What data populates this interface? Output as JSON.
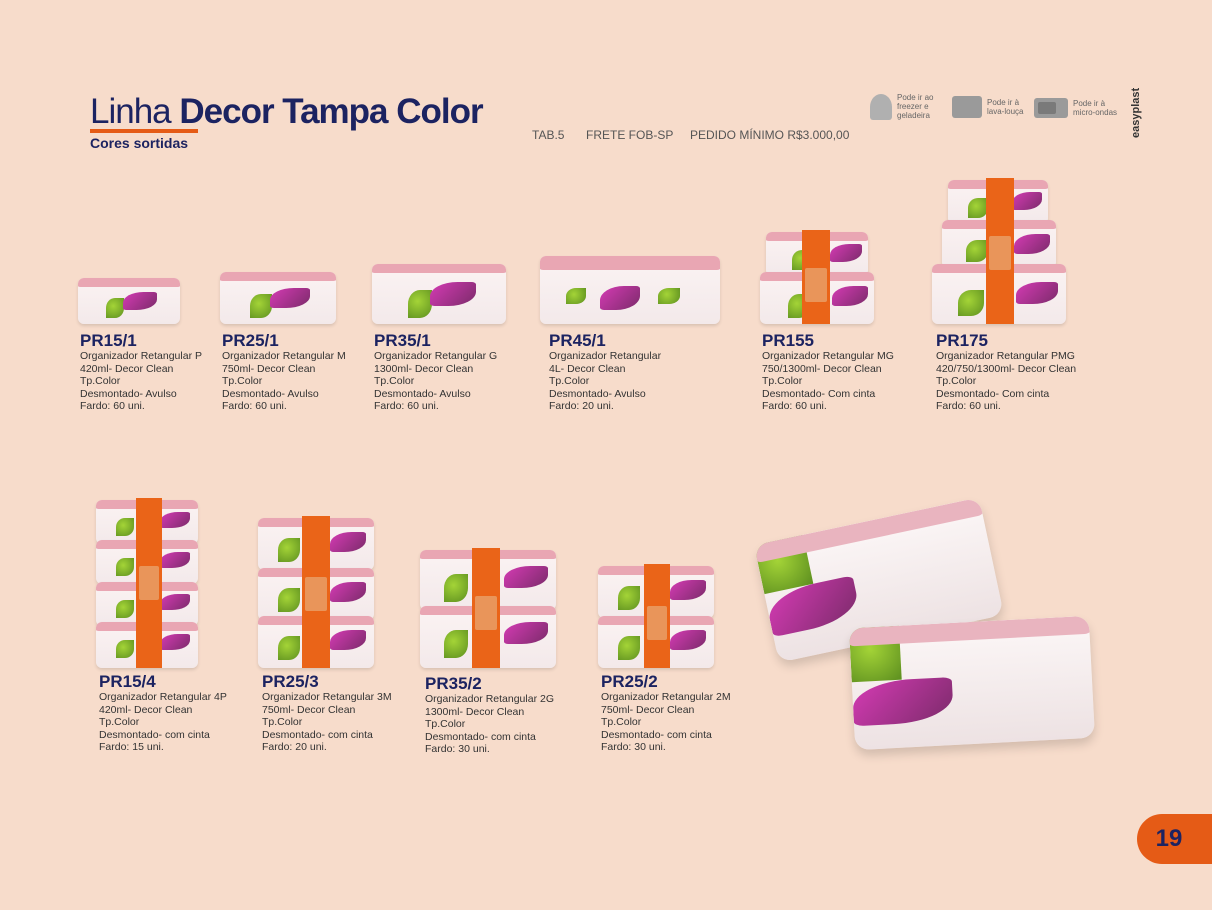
{
  "header": {
    "title_light": "Linha ",
    "title_bold": "Decor Tampa Color",
    "subtitle": "Cores sortidas",
    "tab": "TAB.5",
    "frete": "FRETE FOB-SP",
    "pedido": "PEDIDO MÍNIMO R$3.000,00"
  },
  "features": [
    {
      "icon": "snowflake-freezer-icon",
      "label1": "Pode ir ao",
      "label2": "freezer e",
      "label3": "geladeira"
    },
    {
      "icon": "dishwasher-icon",
      "label1": "Pode ir à",
      "label2": "lava-louça",
      "label3": ""
    },
    {
      "icon": "microwave-icon",
      "label1": "Pode ir à",
      "label2": "micro-ondas",
      "label3": ""
    }
  ],
  "brand": "easyplast",
  "products_top": [
    {
      "code": "PR15/1",
      "l1": "Organizador Retangular P",
      "l2": "420ml- Decor Clean",
      "l3": "Tp.Color",
      "l4": "Desmontado- Avulso",
      "l5": "Fardo: 60 uni."
    },
    {
      "code": "PR25/1",
      "l1": "Organizador Retangular M",
      "l2": "750ml- Decor Clean",
      "l3": "Tp.Color",
      "l4": "Desmontado- Avulso",
      "l5": "Fardo: 60 uni."
    },
    {
      "code": "PR35/1",
      "l1": "Organizador Retangular G",
      "l2": "1300ml- Decor Clean",
      "l3": "Tp.Color",
      "l4": "Desmontado- Avulso",
      "l5": "Fardo: 60 uni."
    },
    {
      "code": "PR45/1",
      "l1": "Organizador Retangular",
      "l2": "4L- Decor Clean",
      "l3": "Tp.Color",
      "l4": "Desmontado- Avulso",
      "l5": "Fardo: 20 uni."
    },
    {
      "code": "PR155",
      "l1": "Organizador Retangular MG",
      "l2": "750/1300ml- Decor Clean",
      "l3": "Tp.Color",
      "l4": "Desmontado- Com cinta",
      "l5": "Fardo: 60 uni."
    },
    {
      "code": "PR175",
      "l1": "Organizador Retangular PMG",
      "l2": "420/750/1300ml- Decor Clean",
      "l3": "Tp.Color",
      "l4": "Desmontado- Com cinta",
      "l5": "Fardo: 60 uni."
    }
  ],
  "products_bottom": [
    {
      "code": "PR15/4",
      "l1": "Organizador Retangular 4P",
      "l2": "420ml- Decor Clean",
      "l3": "Tp.Color",
      "l4": "Desmontado- com cinta",
      "l5": "Fardo: 15 uni."
    },
    {
      "code": "PR25/3",
      "l1": "Organizador Retangular 3M",
      "l2": "750ml- Decor Clean",
      "l3": "Tp.Color",
      "l4": "Desmontado- com cinta",
      "l5": "Fardo: 20 uni."
    },
    {
      "code": "PR35/2",
      "l1": "Organizador Retangular 2G",
      "l2": "1300ml- Decor Clean",
      "l3": "Tp.Color",
      "l4": "Desmontado- com cinta",
      "l5": "Fardo: 30 uni."
    },
    {
      "code": "PR25/2",
      "l1": "Organizador Retangular 2M",
      "l2": "750ml- Decor Clean",
      "l3": "Tp.Color",
      "l4": "Desmontado- com cinta",
      "l5": "Fardo: 30 uni."
    }
  ],
  "page_number": "19",
  "colors": {
    "accent": "#e55b16",
    "navy": "#1c2361",
    "background": "#f7dccb",
    "lid_pink": "#e9a6b3"
  }
}
